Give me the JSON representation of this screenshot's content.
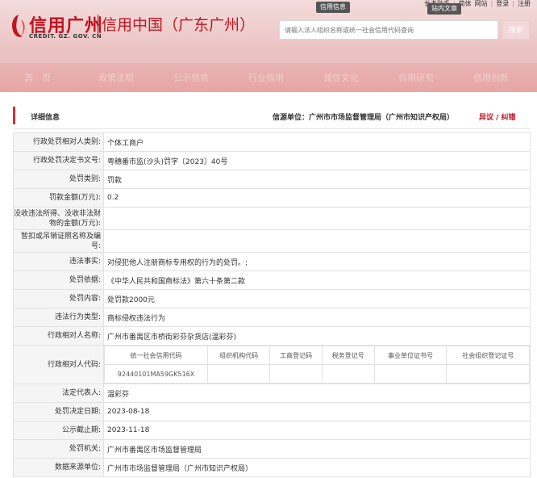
{
  "brand": {
    "logo_cn": "信用广州",
    "logo_en": "CREDIT. GZ. GOV. CN",
    "site_sub": "信用中国（广东广州）",
    "accent": "#c0141f"
  },
  "topbar": {
    "items": [
      "长者助手",
      "简体",
      "网站",
      "登录",
      "注册"
    ],
    "tip_credit": "信用信息",
    "tip_site": "站内文章"
  },
  "search": {
    "placeholder": "请输入法人组织名称或统一社会信用代码查询",
    "button": "搜索"
  },
  "nav": [
    "首　页",
    "政策法规",
    "公示信息",
    "行业信用",
    "诚信文化",
    "信用研究",
    "信用创新"
  ],
  "card": {
    "title": "详细信息",
    "source_label": "信源单位：",
    "source_value": "广州市市场监督管理局（广州市知识产权局）",
    "objection": "异议 / 纠错"
  },
  "rows": [
    {
      "label": "行政处罚相对人类别:",
      "value": "个体工商户"
    },
    {
      "label": "行政处罚决定书文号:",
      "value": "粤穗番市监(沙头)罚字〔2023〕40号"
    },
    {
      "label": "处罚类别:",
      "value": "罚款"
    },
    {
      "label": "罚款金额(万元):",
      "value": "0.2"
    },
    {
      "label": "没收违法所得、没收非法财物的金额(万元):",
      "value": ""
    },
    {
      "label": "暂扣或吊销证照名称及编号:",
      "value": ""
    },
    {
      "label": "违法事实:",
      "value": "对侵犯他人注册商标专用权的行为的处罚。;"
    },
    {
      "label": "处罚依据:",
      "value": "《中华人民共和国商标法》第六十条第二款"
    },
    {
      "label": "处罚内容:",
      "value": "处罚款2000元"
    },
    {
      "label": "违法行为类型:",
      "value": "商标侵权违法行为"
    },
    {
      "label": "行政相对人名称:",
      "value": "广州市番禺区市桥街彩芬杂货店(温彩芬)"
    }
  ],
  "code_row": {
    "label": "行政相对人代码:",
    "headers": [
      "统一社会信用代码",
      "组织机构代码",
      "工商登记码",
      "税务登记号",
      "事业单位证书号",
      "社会组织登记证号"
    ],
    "values": [
      "92440101MA59GK516X",
      "",
      "",
      "",
      "",
      ""
    ]
  },
  "rows_after": [
    {
      "label": "法定代表人:",
      "value": "温彩芬"
    },
    {
      "label": "处罚决定日期:",
      "value": "2023-08-18"
    },
    {
      "label": "公示截止期:",
      "value": "2023-11-18"
    },
    {
      "label": "处罚机关:",
      "value": "广州市番禺区市场监督管理局"
    },
    {
      "label": "数据来源单位:",
      "value": "广州市市场监督管理局（广州市知识产权局）"
    }
  ]
}
